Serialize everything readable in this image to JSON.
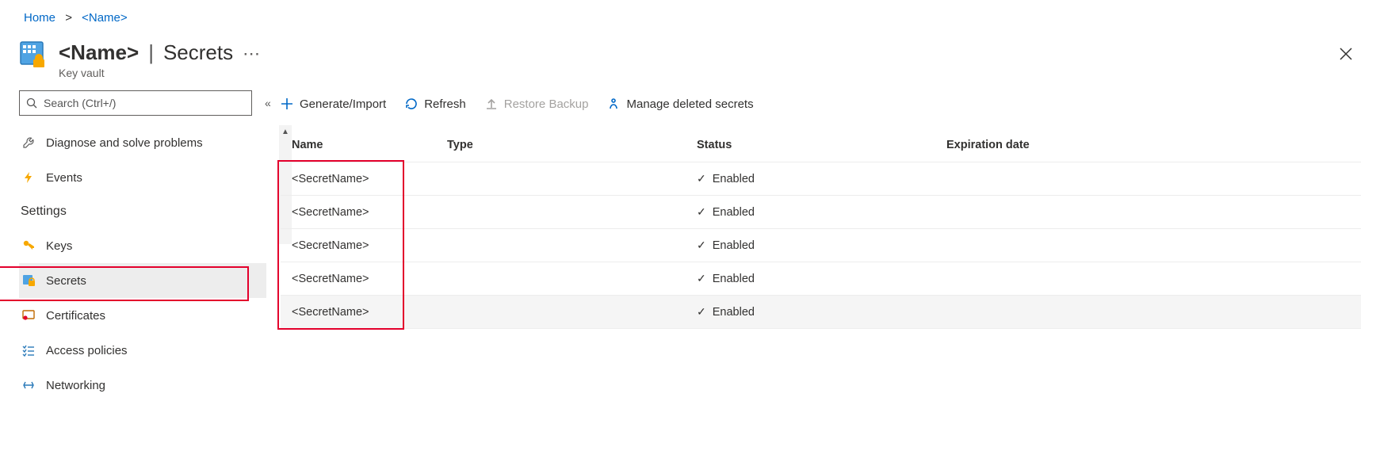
{
  "breadcrumb": {
    "home": "Home",
    "name": "<Name>"
  },
  "header": {
    "name": "<Name>",
    "section": "Secrets",
    "subtitle": "Key vault"
  },
  "search": {
    "placeholder": "Search (Ctrl+/)"
  },
  "sidebar": {
    "diagnose": "Diagnose and solve problems",
    "events": "Events",
    "settings_heading": "Settings",
    "keys": "Keys",
    "secrets": "Secrets",
    "certificates": "Certificates",
    "access_policies": "Access policies",
    "networking": "Networking"
  },
  "toolbar": {
    "generate": "Generate/Import",
    "refresh": "Refresh",
    "restore": "Restore Backup",
    "manage_deleted": "Manage deleted secrets"
  },
  "table": {
    "headers": {
      "name": "Name",
      "type": "Type",
      "status": "Status",
      "expiration": "Expiration date"
    },
    "rows": [
      {
        "name": "<SecretName>",
        "type": "",
        "status": "Enabled",
        "expiration": ""
      },
      {
        "name": "<SecretName>",
        "type": "",
        "status": "Enabled",
        "expiration": ""
      },
      {
        "name": "<SecretName>",
        "type": "",
        "status": "Enabled",
        "expiration": ""
      },
      {
        "name": "<SecretName>",
        "type": "",
        "status": "Enabled",
        "expiration": ""
      },
      {
        "name": "<SecretName>",
        "type": "",
        "status": "Enabled",
        "expiration": ""
      }
    ]
  }
}
